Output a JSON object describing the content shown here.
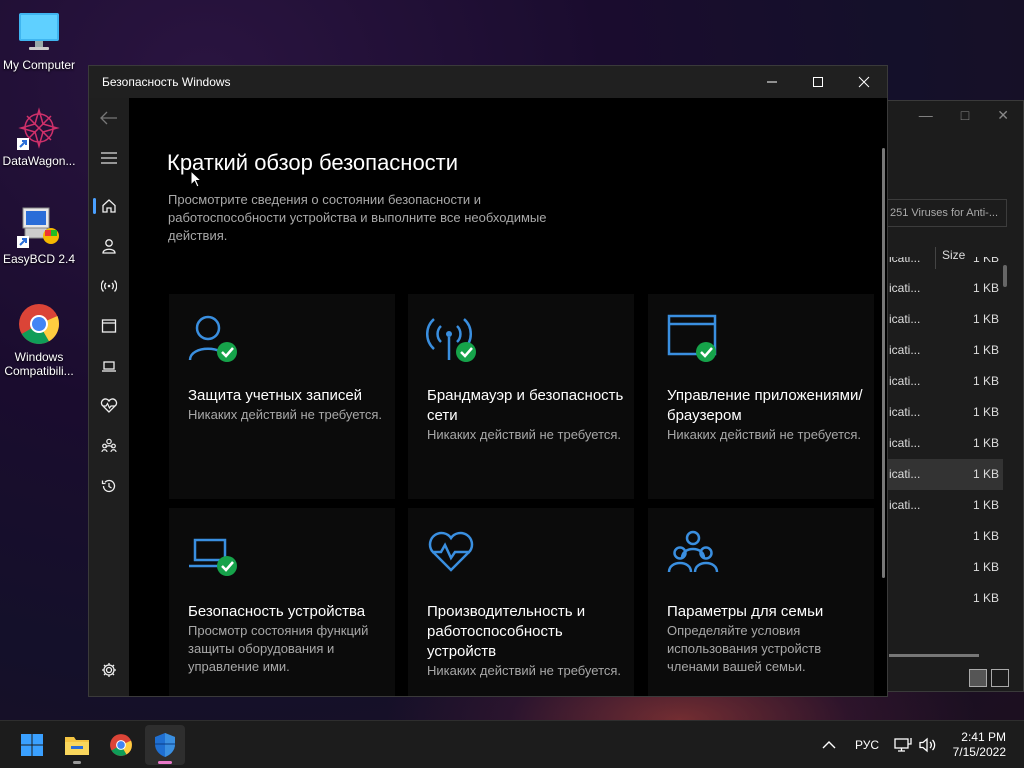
{
  "desktop": {
    "icons": [
      {
        "label": "My Computer"
      },
      {
        "label": "DataWagon..."
      },
      {
        "label": "EasyBCD 2.4"
      },
      {
        "label": "Windows Compatibili..."
      }
    ]
  },
  "explorer": {
    "search_text": "251 Viruses for Anti-...",
    "size_header": "Size",
    "rows": [
      {
        "name": "icati...",
        "size": "1 KB"
      },
      {
        "name": "icati...",
        "size": "1 KB"
      },
      {
        "name": "icati...",
        "size": "1 KB"
      },
      {
        "name": "icati...",
        "size": "1 KB"
      },
      {
        "name": "icati...",
        "size": "1 KB"
      },
      {
        "name": "icati...",
        "size": "1 KB"
      },
      {
        "name": "icati...",
        "size": "1 KB"
      },
      {
        "name": "icati...",
        "size": "1 KB"
      },
      {
        "name": "icati...",
        "size": "1 KB"
      },
      {
        "name": "",
        "size": "1 KB"
      },
      {
        "name": "",
        "size": "1 KB"
      },
      {
        "name": "",
        "size": "1 KB"
      }
    ]
  },
  "window": {
    "title": "Безопасность Windows",
    "heading": "Краткий обзор безопасности",
    "subtitle": "Просмотрите сведения о состоянии безопасности и работоспособности устройства и выполните все необходимые действия.",
    "tiles": [
      {
        "title": "Защита учетных записей",
        "desc": "Никаких действий не требуется."
      },
      {
        "title": "Брандмауэр и безопасность сети",
        "desc": "Никаких действий не требуется."
      },
      {
        "title": "Управление приложениями/браузером",
        "desc": "Никаких действий не требуется."
      },
      {
        "title": "Безопасность устройства",
        "desc": "Просмотр состояния функций защиты оборудования и управление ими."
      },
      {
        "title": "Производительность и работоспособность устройств",
        "desc": "Никаких действий не требуется."
      },
      {
        "title": "Параметры для семьи",
        "desc": "Определяйте условия использования устройств членами вашей семьи."
      }
    ]
  },
  "taskbar": {
    "language": "РУС",
    "time": "2:41 PM",
    "date": "7/15/2022"
  },
  "colors": {
    "accent": "#3a8fe0",
    "check": "#16a34a"
  }
}
